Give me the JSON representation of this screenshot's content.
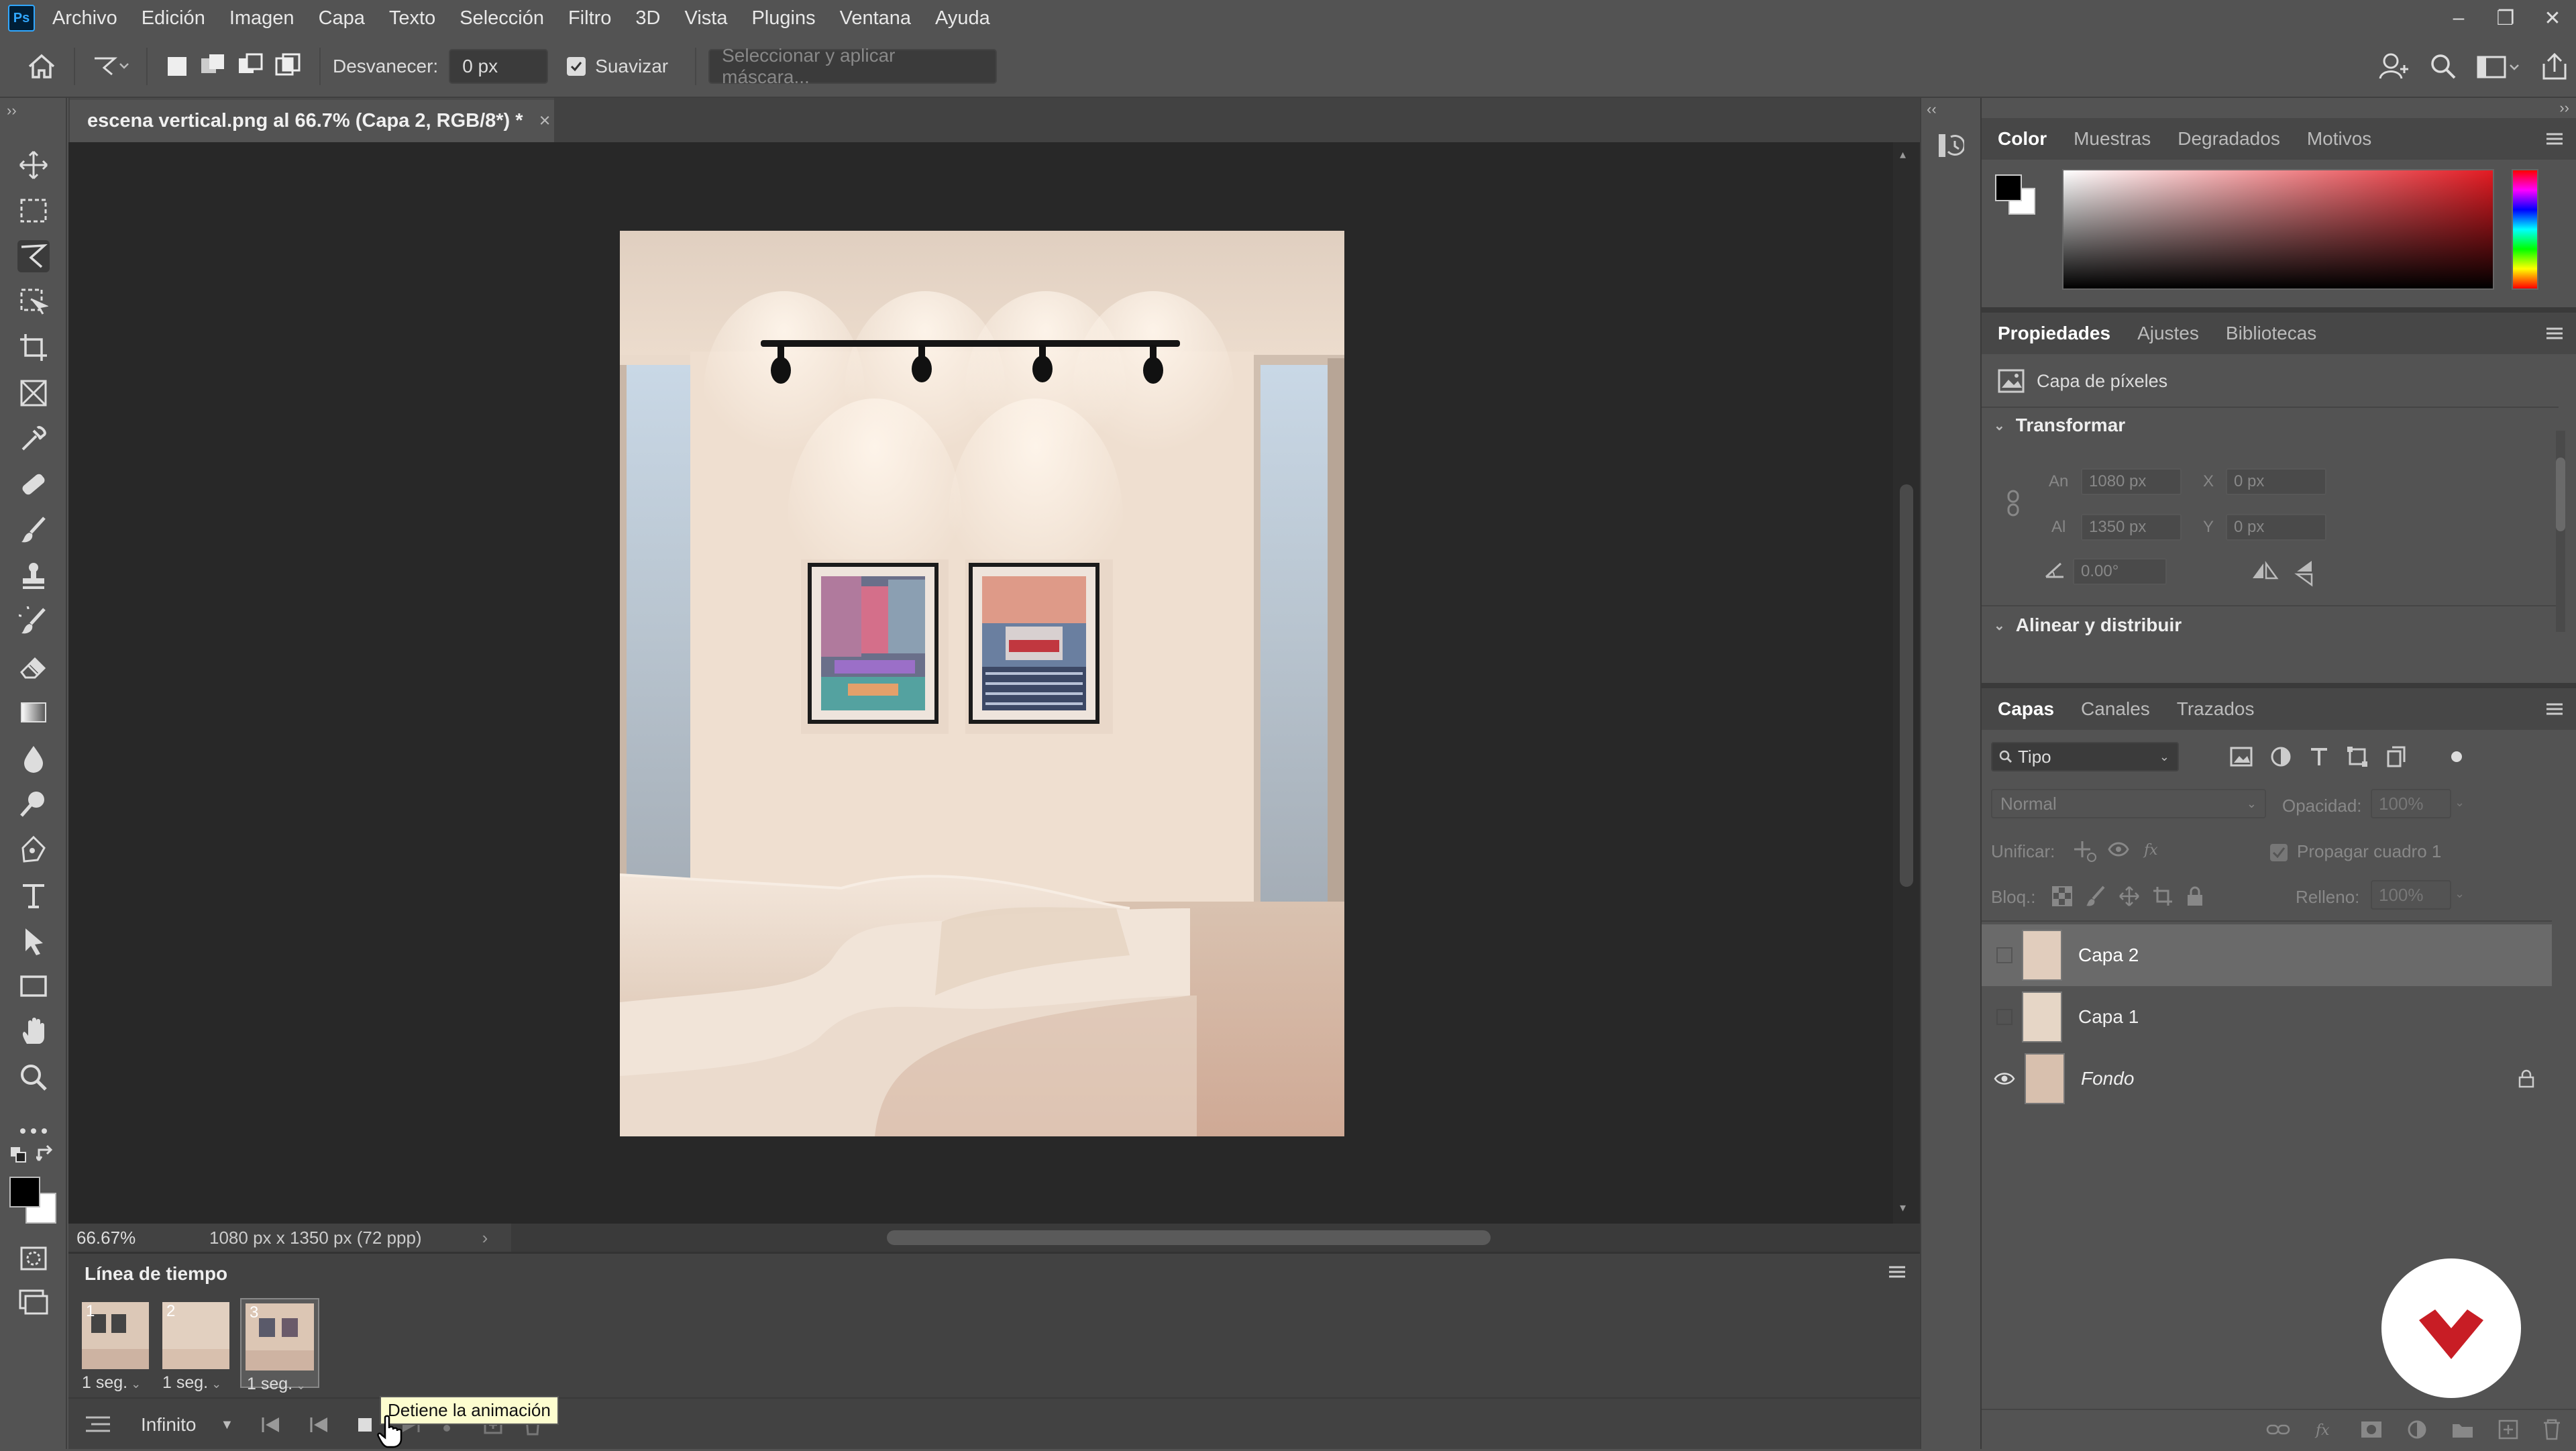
{
  "app": {
    "logo": "Ps"
  },
  "menu": [
    "Archivo",
    "Edición",
    "Imagen",
    "Capa",
    "Texto",
    "Selección",
    "Filtro",
    "3D",
    "Vista",
    "Plugins",
    "Ventana",
    "Ayuda"
  ],
  "window_controls": [
    "–",
    "❐",
    "✕"
  ],
  "options": {
    "feather_label": "Desvanecer:",
    "feather_value": "0 px",
    "smooth_label": "Suavizar",
    "mask_button": "Seleccionar y aplicar máscara..."
  },
  "document": {
    "tab_title": "escena vertical.png al 66.7% (Capa 2, RGB/8*) *",
    "close": "×"
  },
  "status": {
    "zoom": "66.67%",
    "info": "1080 px x 1350 px (72 ppp)",
    "arrow": "›"
  },
  "timeline": {
    "title": "Línea de tiempo",
    "frames": [
      {
        "num": "1",
        "delay": "1 seg."
      },
      {
        "num": "2",
        "delay": "1 seg."
      },
      {
        "num": "3",
        "delay": "1 seg."
      }
    ],
    "loop": "Infinito",
    "tooltip": "Detiene la animación"
  },
  "color_panel": {
    "tabs": [
      "Color",
      "Muestras",
      "Degradados",
      "Motivos"
    ]
  },
  "properties_panel": {
    "tabs": [
      "Propiedades",
      "Ajustes",
      "Bibliotecas"
    ],
    "layer_type": "Capa de píxeles",
    "transform_title": "Transformar",
    "width_label": "An",
    "width_value": "1080 px",
    "height_label": "Al",
    "height_value": "1350 px",
    "x_label": "X",
    "x_value": "0 px",
    "y_label": "Y",
    "y_value": "0 px",
    "angle_value": "0.00°",
    "align_title": "Alinear y distribuir"
  },
  "layers_panel": {
    "tabs": [
      "Capas",
      "Canales",
      "Trazados"
    ],
    "filter_kind": "Tipo",
    "blend_mode": "Normal",
    "opacity_label": "Opacidad:",
    "opacity_value": "100%",
    "unify_label": "Unificar:",
    "propagate_label": "Propagar cuadro 1",
    "lock_label": "Bloq.:",
    "fill_label": "Relleno:",
    "fill_value": "100%",
    "layers": [
      {
        "name": "Capa 2"
      },
      {
        "name": "Capa 1"
      },
      {
        "name": "Fondo"
      }
    ]
  },
  "colors": {
    "bg": "#535353",
    "canvas_bg": "#282828",
    "accent": "#31a8ff"
  }
}
